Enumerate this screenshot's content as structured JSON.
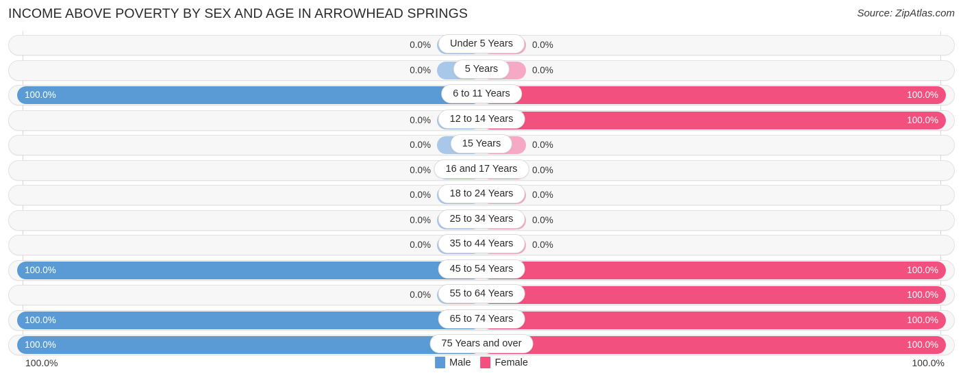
{
  "header": {
    "title": "INCOME ABOVE POVERTY BY SEX AND AGE IN ARROWHEAD SPRINGS",
    "source": "Source: ZipAtlas.com"
  },
  "footer": {
    "axis_left": "100.0%",
    "axis_right": "100.0%",
    "legend": [
      {
        "label": "Male",
        "color": "#5b9bd5"
      },
      {
        "label": "Female",
        "color": "#f2507f"
      }
    ]
  },
  "colors": {
    "male_full": "#5b9bd5",
    "male_zero": "#a9c7e8",
    "female_full": "#f2507f",
    "female_zero": "#f5a9c5",
    "track": "#f7f7f7",
    "track_border": "#e2e2e2",
    "gridline": "#d9d9d9"
  },
  "chart_data": {
    "type": "bar",
    "orientation": "horizontal",
    "layout": "diverging-paired",
    "title": "INCOME ABOVE POVERTY BY SEX AND AGE IN ARROWHEAD SPRINGS",
    "xlabel": "",
    "ylabel": "",
    "xlim": [
      0,
      100
    ],
    "unit": "%",
    "grid": true,
    "legend_position": "bottom-center",
    "categories": [
      "Under 5 Years",
      "5 Years",
      "6 to 11 Years",
      "12 to 14 Years",
      "15 Years",
      "16 and 17 Years",
      "18 to 24 Years",
      "25 to 34 Years",
      "35 to 44 Years",
      "45 to 54 Years",
      "55 to 64 Years",
      "65 to 74 Years",
      "75 Years and over"
    ],
    "series": [
      {
        "name": "Male",
        "color": "#5b9bd5",
        "values": [
          0.0,
          0.0,
          100.0,
          0.0,
          0.0,
          0.0,
          0.0,
          0.0,
          0.0,
          100.0,
          0.0,
          100.0,
          100.0
        ],
        "labels": [
          "0.0%",
          "0.0%",
          "100.0%",
          "0.0%",
          "0.0%",
          "0.0%",
          "0.0%",
          "0.0%",
          "0.0%",
          "100.0%",
          "0.0%",
          "100.0%",
          "100.0%"
        ]
      },
      {
        "name": "Female",
        "color": "#f2507f",
        "values": [
          0.0,
          0.0,
          100.0,
          100.0,
          0.0,
          0.0,
          0.0,
          0.0,
          0.0,
          100.0,
          100.0,
          100.0,
          100.0
        ],
        "labels": [
          "0.0%",
          "0.0%",
          "100.0%",
          "100.0%",
          "0.0%",
          "0.0%",
          "0.0%",
          "0.0%",
          "0.0%",
          "100.0%",
          "100.0%",
          "100.0%",
          "100.0%"
        ]
      }
    ]
  }
}
